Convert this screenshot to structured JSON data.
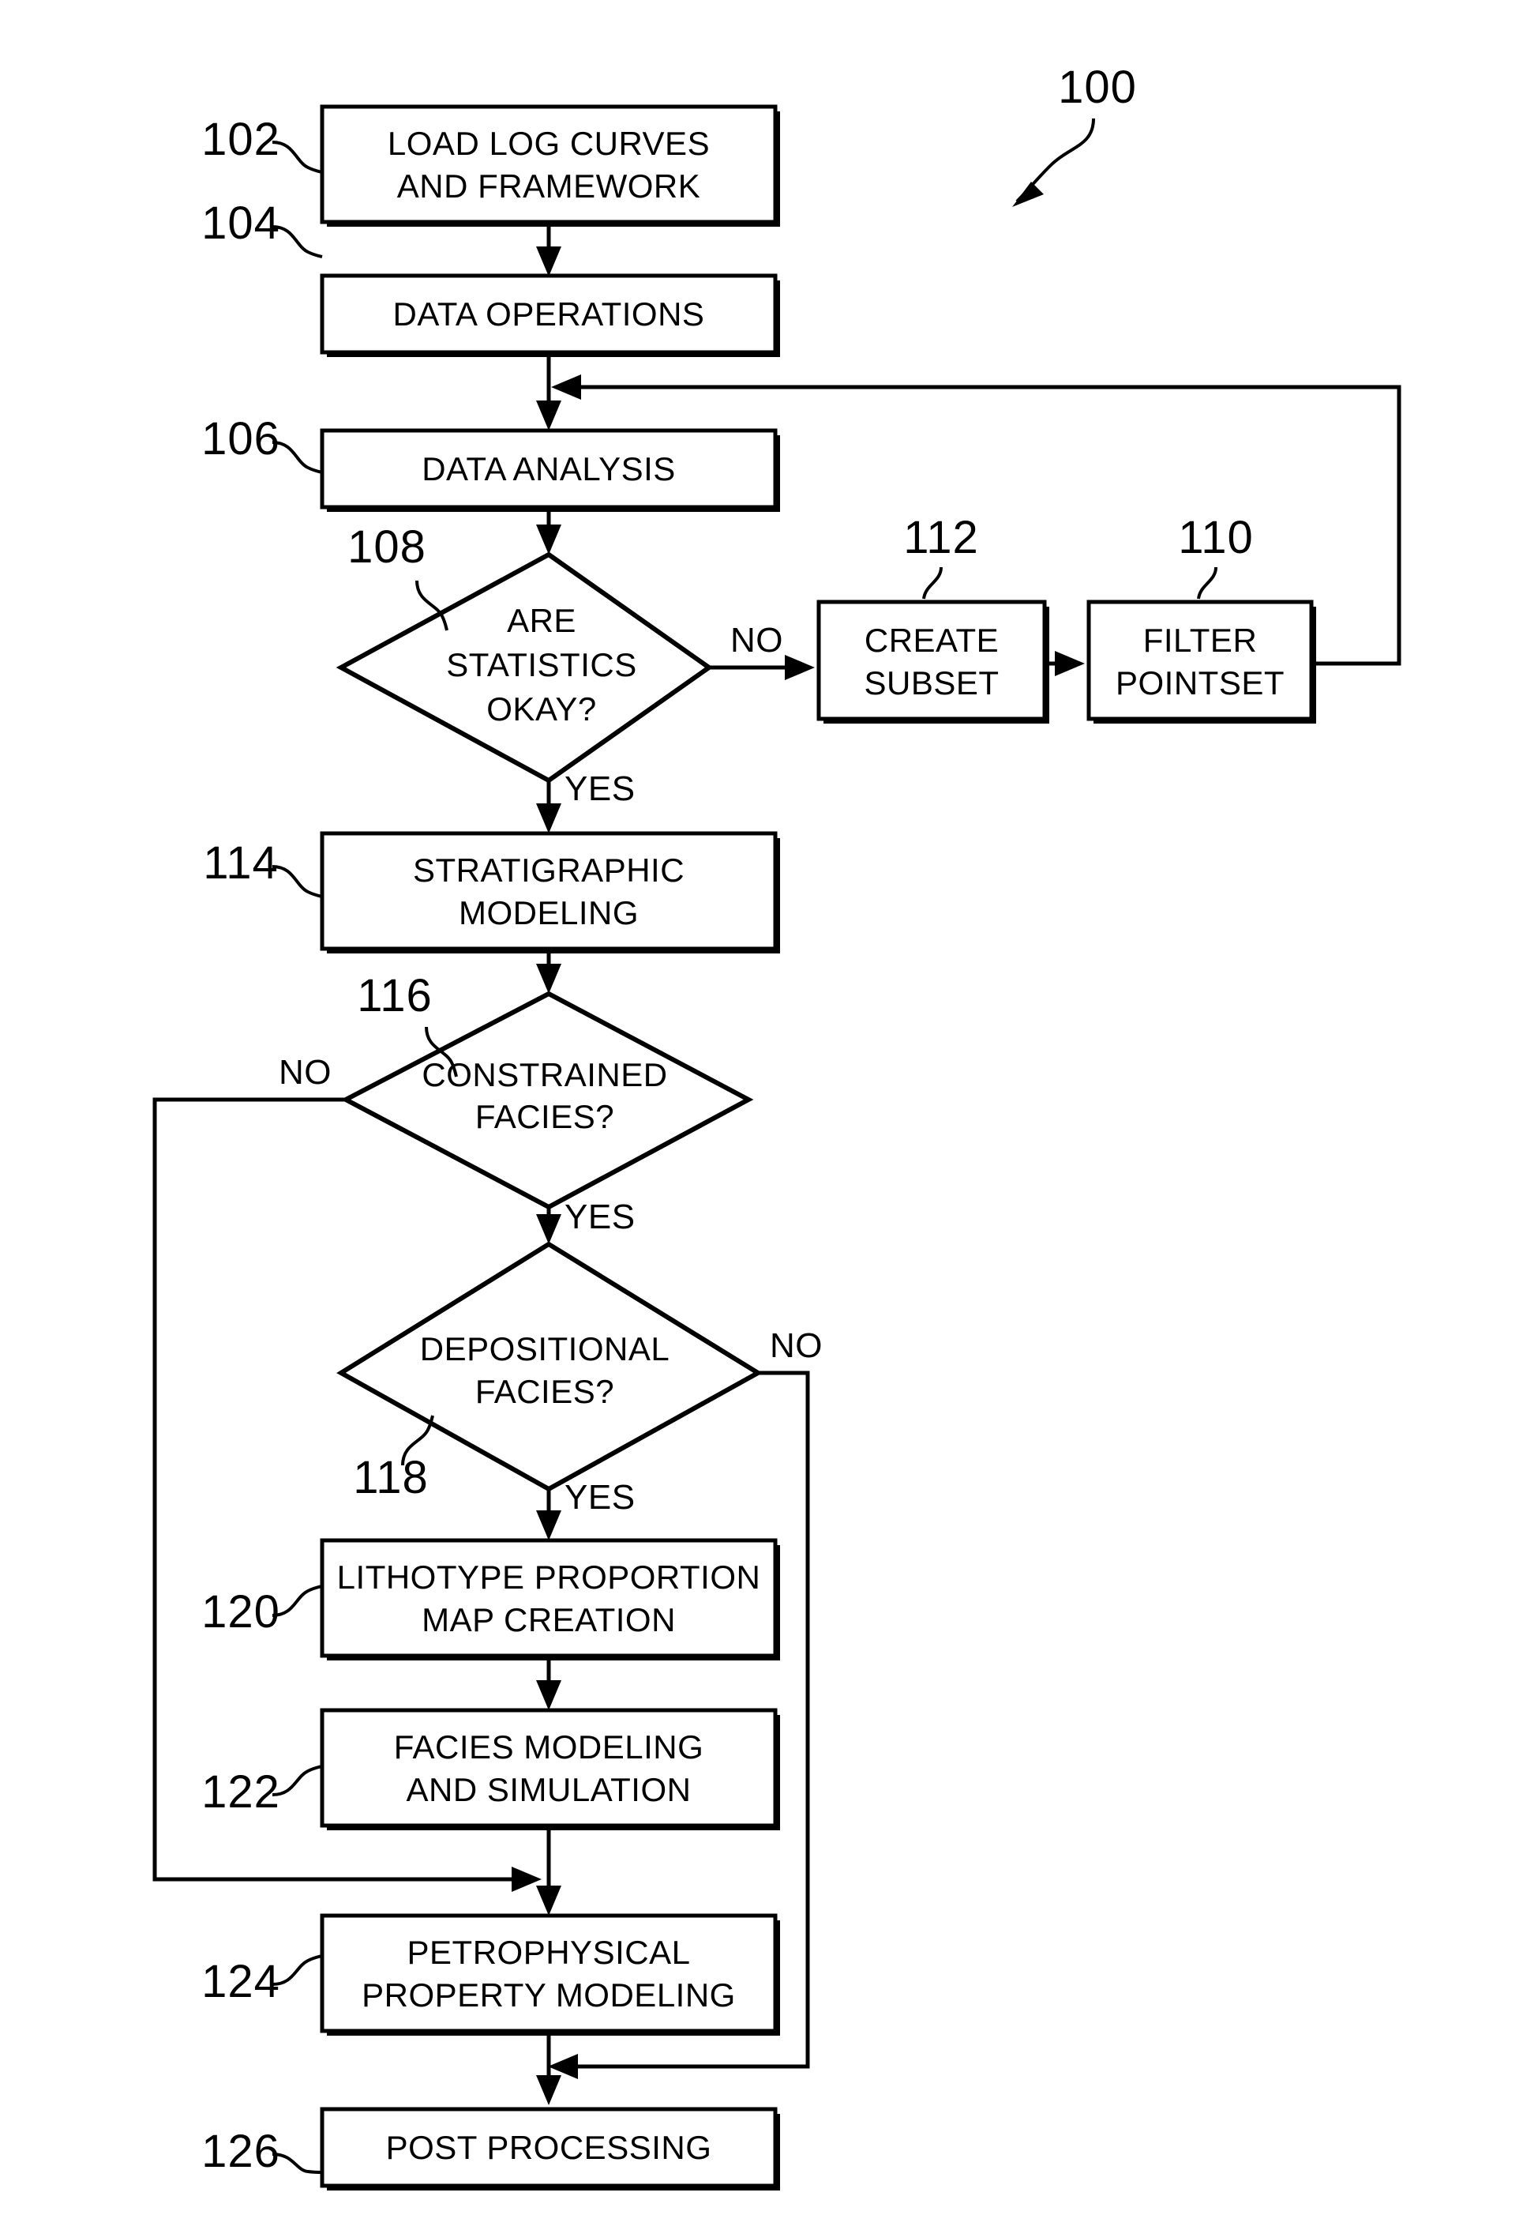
{
  "figure": {
    "reference_label": "100"
  },
  "nodes": [
    {
      "ref": "102",
      "type": "process",
      "lines": [
        "LOAD LOG CURVES",
        "AND FRAMEWORK"
      ]
    },
    {
      "ref": "104",
      "type": "process",
      "lines": [
        "DATA OPERATIONS"
      ]
    },
    {
      "ref": "106",
      "type": "process",
      "lines": [
        "DATA ANALYSIS"
      ]
    },
    {
      "ref": "108",
      "type": "decision",
      "lines": [
        "ARE",
        "STATISTICS",
        "OKAY?"
      ]
    },
    {
      "ref": "112",
      "type": "process",
      "lines": [
        "CREATE",
        "SUBSET"
      ]
    },
    {
      "ref": "110",
      "type": "process",
      "lines": [
        "FILTER",
        "POINTSET"
      ]
    },
    {
      "ref": "114",
      "type": "process",
      "lines": [
        "STRATIGRAPHIC",
        "MODELING"
      ]
    },
    {
      "ref": "116",
      "type": "decision",
      "lines": [
        "CONSTRAINED",
        "FACIES?"
      ]
    },
    {
      "ref": "118",
      "type": "decision",
      "lines": [
        "DEPOSITIONAL",
        "FACIES?"
      ]
    },
    {
      "ref": "120",
      "type": "process",
      "lines": [
        "LITHOTYPE PROPORTION",
        "MAP CREATION"
      ]
    },
    {
      "ref": "122",
      "type": "process",
      "lines": [
        "FACIES MODELING",
        "AND SIMULATION"
      ]
    },
    {
      "ref": "124",
      "type": "process",
      "lines": [
        "PETROPHYSICAL",
        "PROPERTY MODELING"
      ]
    },
    {
      "ref": "126",
      "type": "process",
      "lines": [
        "POST PROCESSING"
      ]
    }
  ],
  "branch_labels": {
    "stats_no": "NO",
    "stats_yes": "YES",
    "constrained_no": "NO",
    "constrained_yes": "YES",
    "depositional_no": "NO",
    "depositional_yes": "YES"
  },
  "node_text": {
    "n102_l1": "LOAD LOG CURVES",
    "n102_l2": "AND FRAMEWORK",
    "n104_l1": "DATA OPERATIONS",
    "n106_l1": "DATA ANALYSIS",
    "n108_l1": "ARE",
    "n108_l2": "STATISTICS",
    "n108_l3": "OKAY?",
    "n112_l1": "CREATE",
    "n112_l2": "SUBSET",
    "n110_l1": "FILTER",
    "n110_l2": "POINTSET",
    "n114_l1": "STRATIGRAPHIC",
    "n114_l2": "MODELING",
    "n116_l1": "CONSTRAINED",
    "n116_l2": "FACIES?",
    "n118_l1": "DEPOSITIONAL",
    "n118_l2": "FACIES?",
    "n120_l1": "LITHOTYPE PROPORTION",
    "n120_l2": "MAP CREATION",
    "n122_l1": "FACIES MODELING",
    "n122_l2": "AND SIMULATION",
    "n124_l1": "PETROPHYSICAL",
    "n124_l2": "PROPERTY MODELING",
    "n126_l1": "POST PROCESSING"
  },
  "ref_numbers": {
    "r100": "100",
    "r102": "102",
    "r104": "104",
    "r106": "106",
    "r108": "108",
    "r110": "110",
    "r112": "112",
    "r114": "114",
    "r116": "116",
    "r118": "118",
    "r120": "120",
    "r122": "122",
    "r124": "124",
    "r126": "126"
  },
  "colors": {
    "stroke": "#000000",
    "fill": "#ffffff",
    "background": "#ffffff"
  }
}
